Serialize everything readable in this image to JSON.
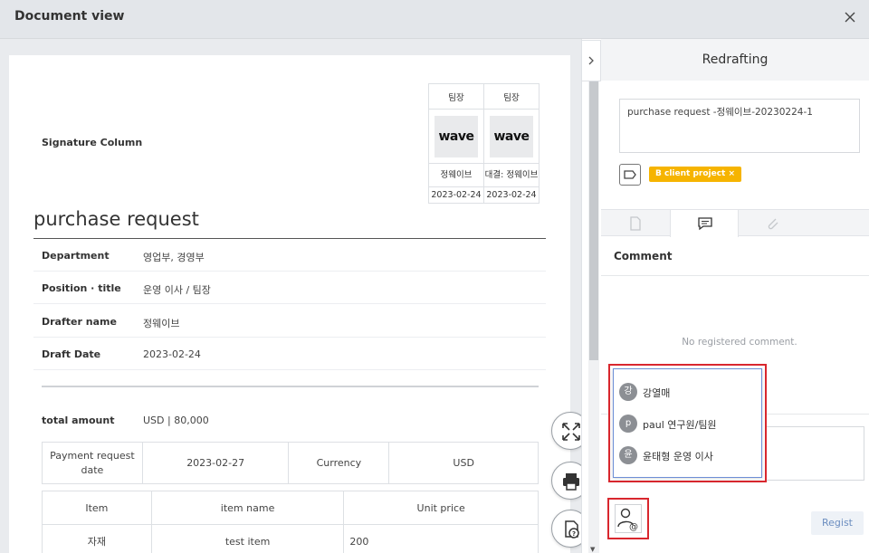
{
  "window": {
    "title": "Document view"
  },
  "signature": {
    "label": "Signature Column",
    "columns": [
      {
        "role": "팀장",
        "stamp": "wave",
        "name": "정웨이브",
        "date": "2023-02-24"
      },
      {
        "role": "팀장",
        "stamp": "wave",
        "name": "대결: 정웨이브",
        "date": "2023-02-24"
      }
    ]
  },
  "document": {
    "title": "purchase request",
    "fields": [
      {
        "label": "Department",
        "value": "영업부, 경영부"
      },
      {
        "label": "Position · title",
        "value": "운영 이사 / 팀장"
      },
      {
        "label": "Drafter name",
        "value": "정웨이브"
      },
      {
        "label": "Draft Date",
        "value": "2023-02-24"
      }
    ],
    "total": {
      "label": "total amount",
      "value": "USD | 80,000"
    },
    "payment": {
      "request_date_label": "Payment request date",
      "request_date": "2023-02-27",
      "currency_label": "Currency",
      "currency": "USD"
    },
    "items_table": {
      "headers": [
        "Item",
        "item name",
        "Unit price"
      ],
      "rows": [
        [
          "자재",
          "test item",
          "200"
        ]
      ]
    }
  },
  "panel": {
    "title": "Redrafting",
    "redraft_text": "purchase request -정웨이브-20230224-1",
    "tag_label": "B client project ×",
    "tabs": [
      "approval-doc",
      "comment",
      "attachment"
    ],
    "comment_heading": "Comment",
    "no_comment": "No registered comment.",
    "register_label": "Regist"
  },
  "mentions": [
    {
      "avatar": "강",
      "name": "강열매"
    },
    {
      "avatar": "p",
      "name": "paul 연구원/팀원"
    },
    {
      "avatar": "윤",
      "name": "윤태형 운영 이사"
    }
  ],
  "colors": {
    "tag": "#f6b400",
    "highlight": "#d9272e",
    "register_text": "#6c8ec0"
  }
}
